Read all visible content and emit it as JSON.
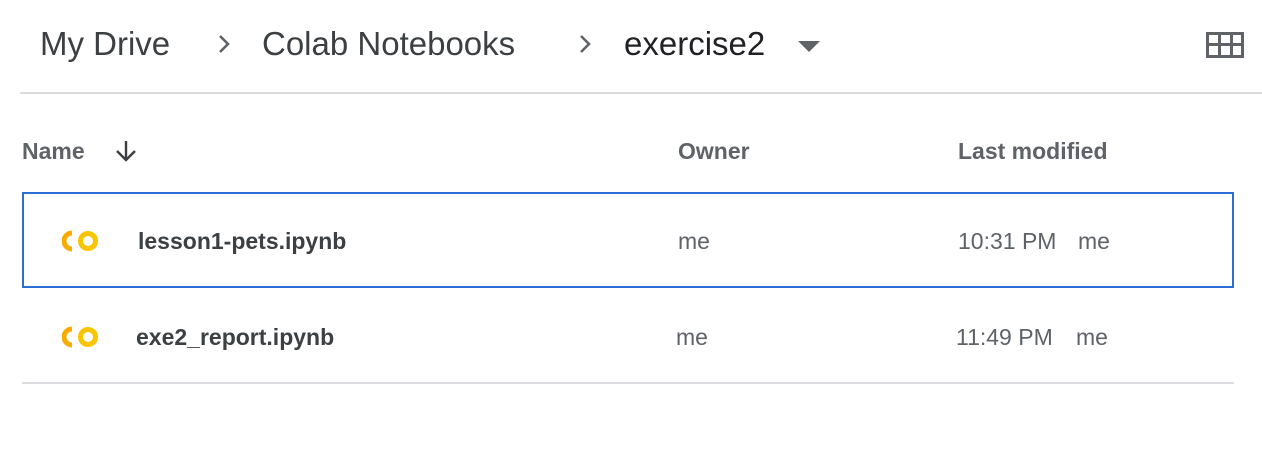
{
  "breadcrumb": {
    "items": [
      "My Drive",
      "Colab Notebooks",
      "exercise2"
    ]
  },
  "columns": {
    "name": "Name",
    "owner": "Owner",
    "last_modified": "Last modified"
  },
  "files": [
    {
      "name": "lesson1-pets.ipynb",
      "owner": "me",
      "modified": "10:31 PM",
      "modified_by": "me",
      "icon": "colab-icon",
      "selected": true
    },
    {
      "name": "exe2_report.ipynb",
      "owner": "me",
      "modified": "11:49 PM",
      "modified_by": "me",
      "icon": "colab-icon",
      "selected": false
    }
  ],
  "colors": {
    "selection_border": "#2b6fd6",
    "colab_icon": "#f9ab00"
  }
}
